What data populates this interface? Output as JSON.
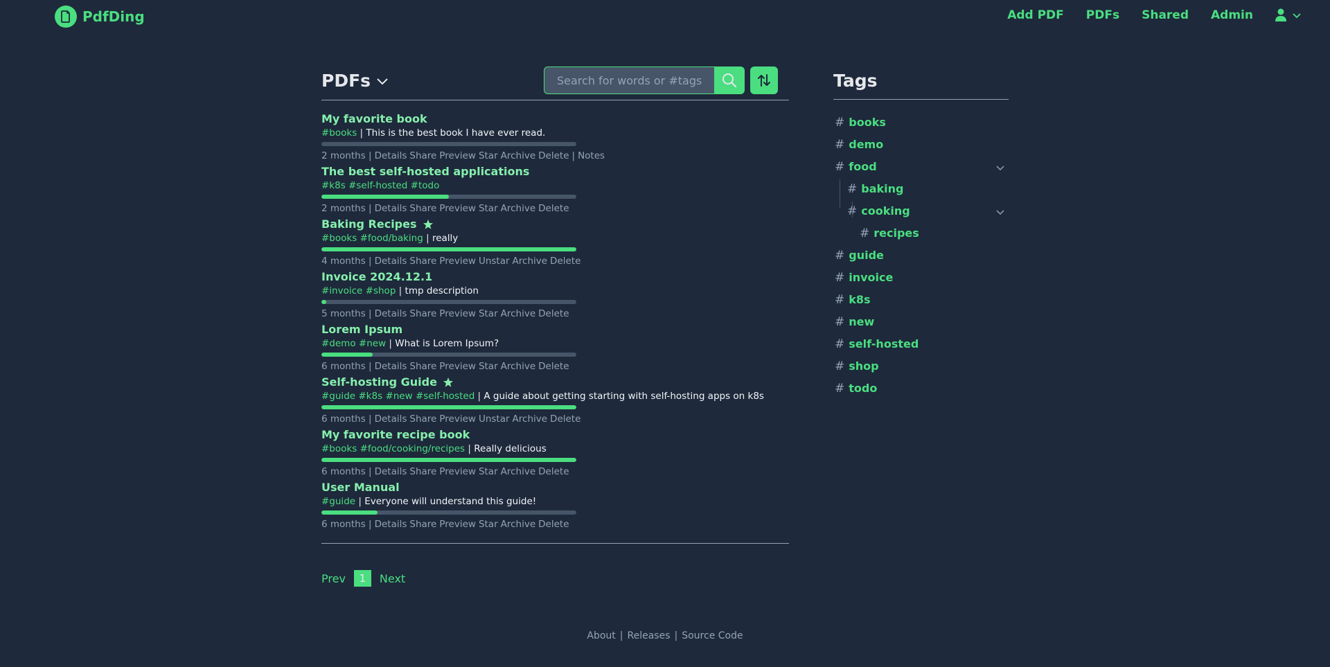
{
  "brand": {
    "name": "PdfDing",
    "logo_icon": "pdf-file-icon"
  },
  "nav": {
    "add_pdf": "Add PDF",
    "pdfs": "PDFs",
    "shared": "Shared",
    "admin": "Admin"
  },
  "list": {
    "title": "PDFs",
    "search_placeholder": "Search for words or #tags",
    "items": [
      {
        "title": "My favorite book",
        "starred": false,
        "tags": [
          "#books"
        ],
        "description": "This is the best book I have ever read.",
        "progress": 0.0,
        "age": "2 months",
        "actions": [
          "Details",
          "Share",
          "Preview",
          "Star",
          "Archive",
          "Delete"
        ],
        "extra_action": "Notes"
      },
      {
        "title": "The best self-hosted applications",
        "starred": false,
        "tags": [
          "#k8s",
          "#self-hosted",
          "#todo"
        ],
        "description": "",
        "progress": 0.5,
        "age": "2 months",
        "actions": [
          "Details",
          "Share",
          "Preview",
          "Star",
          "Archive",
          "Delete"
        ]
      },
      {
        "title": "Baking Recipes",
        "starred": true,
        "tags": [
          "#books",
          "#food/baking"
        ],
        "description": "really",
        "progress": 1.0,
        "age": "4 months",
        "actions": [
          "Details",
          "Share",
          "Preview",
          "Unstar",
          "Archive",
          "Delete"
        ]
      },
      {
        "title": "Invoice 2024.12.1",
        "starred": false,
        "tags": [
          "#invoice",
          "#shop"
        ],
        "description": "tmp description",
        "progress": 0.02,
        "age": "5 months",
        "actions": [
          "Details",
          "Share",
          "Preview",
          "Star",
          "Archive",
          "Delete"
        ]
      },
      {
        "title": "Lorem Ipsum",
        "starred": false,
        "tags": [
          "#demo",
          "#new"
        ],
        "description": "What is Lorem Ipsum?",
        "progress": 0.2,
        "age": "6 months",
        "actions": [
          "Details",
          "Share",
          "Preview",
          "Star",
          "Archive",
          "Delete"
        ]
      },
      {
        "title": "Self-hosting Guide",
        "starred": true,
        "tags": [
          "#guide",
          "#k8s",
          "#new",
          "#self-hosted"
        ],
        "description": "A guide about getting starting with self-hosting apps on k8s",
        "progress": 1.0,
        "age": "6 months",
        "actions": [
          "Details",
          "Share",
          "Preview",
          "Unstar",
          "Archive",
          "Delete"
        ]
      },
      {
        "title": "My favorite recipe book",
        "starred": false,
        "tags": [
          "#books",
          "#food/cooking/recipes"
        ],
        "description": "Really delicious",
        "progress": 1.0,
        "age": "6 months",
        "actions": [
          "Details",
          "Share",
          "Preview",
          "Star",
          "Archive",
          "Delete"
        ]
      },
      {
        "title": "User Manual",
        "starred": false,
        "tags": [
          "#guide"
        ],
        "description": "Everyone will understand this guide!",
        "progress": 0.22,
        "age": "6 months",
        "actions": [
          "Details",
          "Share",
          "Preview",
          "Star",
          "Archive",
          "Delete"
        ]
      }
    ]
  },
  "pagination": {
    "prev": "Prev",
    "current": "1",
    "next": "Next"
  },
  "footer": {
    "about": "About",
    "releases": "Releases",
    "source": "Source Code"
  },
  "tags": {
    "title": "Tags",
    "hash": "#",
    "items": [
      {
        "name": "books",
        "level": 0,
        "expandable": false
      },
      {
        "name": "demo",
        "level": 0,
        "expandable": false
      },
      {
        "name": "food",
        "level": 0,
        "expandable": true
      },
      {
        "name": "baking",
        "level": 1,
        "expandable": false
      },
      {
        "name": "cooking",
        "level": 1,
        "expandable": true
      },
      {
        "name": "recipes",
        "level": 2,
        "expandable": false
      },
      {
        "name": "guide",
        "level": 0,
        "expandable": false
      },
      {
        "name": "invoice",
        "level": 0,
        "expandable": false
      },
      {
        "name": "k8s",
        "level": 0,
        "expandable": false
      },
      {
        "name": "new",
        "level": 0,
        "expandable": false
      },
      {
        "name": "self-hosted",
        "level": 0,
        "expandable": false
      },
      {
        "name": "shop",
        "level": 0,
        "expandable": false
      },
      {
        "name": "todo",
        "level": 0,
        "expandable": false
      }
    ]
  },
  "colors": {
    "background": "#1e293b",
    "accent": "#4ade80",
    "title": "#86efac",
    "muted": "#94a3b8",
    "track": "#475569"
  }
}
